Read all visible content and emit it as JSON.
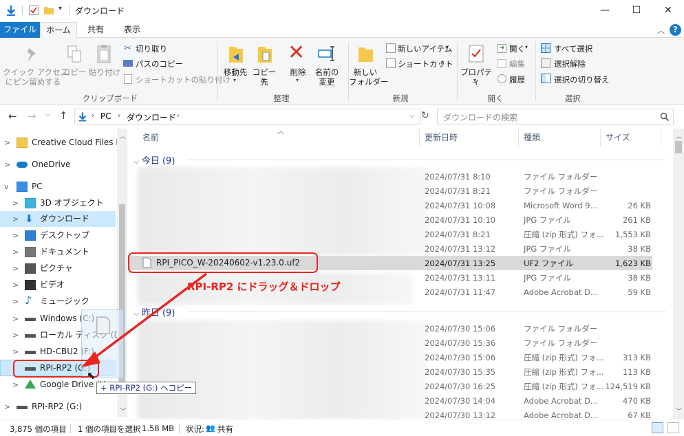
{
  "window": {
    "title": "ダウンロード",
    "minimize": "—",
    "maximize": "☐",
    "close": "✕"
  },
  "ribbon_tabs": [
    "ファイル",
    "ホーム",
    "共有",
    "表示"
  ],
  "ribbon": {
    "clipboard": {
      "pin": "クイック アクセス\nにピン留めする",
      "copy": "コピー",
      "paste": "貼り付け",
      "cut": "切り取り",
      "copy_path": "パスのコピー",
      "paste_shortcut": "ショートカットの貼り付け",
      "label": "クリップボード"
    },
    "organize": {
      "move_to": "移動先",
      "copy_to": "コピー先",
      "delete": "削除",
      "rename": "名前の\n変更",
      "label": "整理"
    },
    "new": {
      "new_folder": "新しい\nフォルダー",
      "new_item": "新しいアイテム",
      "shortcut": "ショートカット",
      "label": "新規"
    },
    "open": {
      "properties": "プロパティ",
      "open": "開く",
      "edit": "編集",
      "history": "履歴",
      "label": "開く"
    },
    "select": {
      "select_all": "すべて選択",
      "select_none": "選択解除",
      "invert": "選択の切り替え",
      "label": "選択"
    }
  },
  "address": {
    "crumbs": [
      "PC",
      "ダウンロード"
    ],
    "search_placeholder": "ダウンロードの検索"
  },
  "nav": [
    {
      "label": "Creative Cloud Files Per",
      "icon": "folder-icon",
      "chev": ">"
    },
    {
      "label": "OneDrive",
      "icon": "cloud-icon",
      "chev": ">"
    },
    {
      "label": "PC",
      "icon": "computer-icon",
      "chev": "v"
    },
    {
      "label": "3D オブジェクト",
      "icon": "cube-icon",
      "chev": ">"
    },
    {
      "label": "ダウンロード",
      "icon": "download-arrow-icon",
      "chev": ">"
    },
    {
      "label": "デスクトップ",
      "icon": "desktop-folder-icon",
      "chev": ">"
    },
    {
      "label": "ドキュメント",
      "icon": "document-icon",
      "chev": ">"
    },
    {
      "label": "ピクチャ",
      "icon": "picture-icon",
      "chev": ">"
    },
    {
      "label": "ビデオ",
      "icon": "video-icon",
      "chev": ">"
    },
    {
      "label": "ミュージック",
      "icon": "music-icon",
      "chev": ">"
    },
    {
      "label": "Windows (C:)",
      "icon": "drive-icon",
      "chev": ">"
    },
    {
      "label": "ローカル ディスク (D:)",
      "icon": "drive-icon",
      "chev": ">"
    },
    {
      "label": "HD-CBU2 (F:)",
      "icon": "drive-icon",
      "chev": ">"
    },
    {
      "label": "RPI-RP2 (G:)",
      "icon": "drive-icon",
      "chev": ""
    },
    {
      "label": "Google Drive (H",
      "icon": "google-drive-icon",
      "chev": ">"
    },
    {
      "label": "RPI-RP2 (G:)",
      "icon": "drive-icon",
      "chev": ">"
    }
  ],
  "columns": [
    "名前",
    "更新日時",
    "種類",
    "サイズ"
  ],
  "groups": {
    "today": "今日 (9)",
    "yesterday": "昨日 (9)"
  },
  "files_today": [
    {
      "date": "2024/07/31 8:10",
      "type": "ファイル フォルダー",
      "size": ""
    },
    {
      "date": "2024/07/31 8:21",
      "type": "ファイル フォルダー",
      "size": ""
    },
    {
      "date": "2024/07/31 10:08",
      "type": "Microsoft Word 9...",
      "size": "26 KB"
    },
    {
      "date": "2024/07/31 10:10",
      "type": "JPG ファイル",
      "size": "261 KB"
    },
    {
      "date": "2024/07/31 8:21",
      "type": "圧縮 (zip 形式) フォ...",
      "size": "1,553 KB"
    },
    {
      "date": "2024/07/31 13:12",
      "type": "JPG ファイル",
      "size": "38 KB"
    },
    {
      "date": "2024/07/31 13:25",
      "type": "UF2 ファイル",
      "size": "1,623 KB",
      "name": "RPI_PICO_W-20240602-v1.23.0.uf2"
    },
    {
      "date": "2024/07/31 13:11",
      "type": "JPG ファイル",
      "size": "38 KB"
    },
    {
      "date": "2024/07/31 11:47",
      "type": "Adobe Acrobat D...",
      "size": "59 KB"
    }
  ],
  "files_yesterday": [
    {
      "date": "2024/07/30 15:06",
      "type": "ファイル フォルダー",
      "size": ""
    },
    {
      "date": "2024/07/30 15:36",
      "type": "ファイル フォルダー",
      "size": ""
    },
    {
      "date": "2024/07/30 15:06",
      "type": "圧縮 (zip 形式) フォ...",
      "size": "313 KB"
    },
    {
      "date": "2024/07/30 15:35",
      "type": "圧縮 (zip 形式) フォ...",
      "size": "113 KB"
    },
    {
      "date": "2024/07/30 16:25",
      "type": "圧縮 (zip 形式) フォ...",
      "size": "124,519 KB"
    },
    {
      "date": "2024/07/30 14:04",
      "type": "Adobe Acrobat D...",
      "size": "470 KB"
    },
    {
      "date": "2024/07/30 13:12",
      "type": "Adobe Acrobat D...",
      "size": "67 KB"
    }
  ],
  "annotation": "RPI-RP2 にドラッグ＆ドロップ",
  "drag_tooltip": "+ RPI-RP2 (G:) へコピー",
  "status": {
    "count": "3,875 個の項目",
    "selected": "1 個の項目を選択",
    "size": "1.58 MB",
    "state_label": "状況:",
    "state_value": "共有"
  },
  "colors": {
    "accent": "#1979ca",
    "annotation_red": "#e8251f",
    "selection": "#cce8ff",
    "selected_row": "#d9d9d9"
  }
}
